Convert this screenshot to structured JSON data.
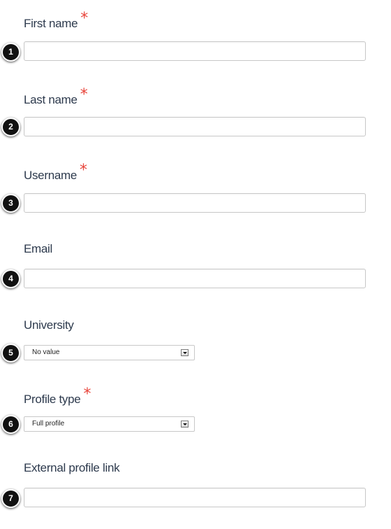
{
  "form": {
    "fields": [
      {
        "label": "First name",
        "required_mark": "*",
        "badge": "1",
        "value": ""
      },
      {
        "label": "Last name",
        "required_mark": "*",
        "badge": "2",
        "value": ""
      },
      {
        "label": "Username",
        "required_mark": "*",
        "badge": "3",
        "value": ""
      },
      {
        "label": "Email",
        "badge": "4",
        "value": ""
      },
      {
        "label": "University",
        "badge": "5",
        "selected": "No value"
      },
      {
        "label": "Profile type",
        "required_mark": "*",
        "badge": "6",
        "selected": "Full profile"
      },
      {
        "label": "External profile link",
        "badge": "7",
        "value": ""
      }
    ]
  },
  "colors": {
    "label_text": "#2d3a4d",
    "required_asterisk": "#e8443a",
    "badge_background": "#111111",
    "input_border": "#c8c8c8"
  }
}
